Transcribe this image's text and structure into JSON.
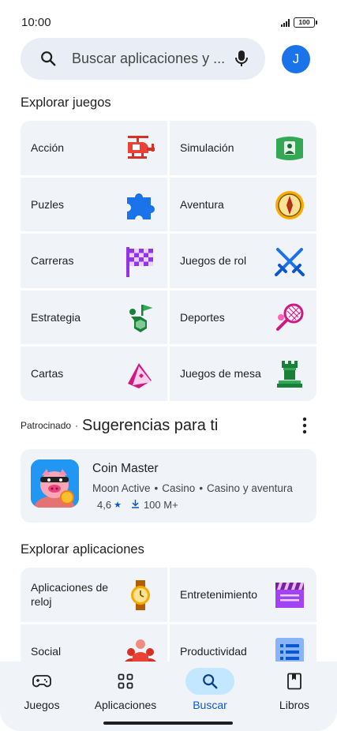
{
  "status_bar": {
    "time": "10:00",
    "battery": "100"
  },
  "search": {
    "placeholder": "Buscar aplicaciones y ...",
    "icon": "search-icon",
    "mic_icon": "mic-icon"
  },
  "account": {
    "initial": "J",
    "color": "#1a73e8"
  },
  "explore_games": {
    "title": "Explorar juegos",
    "categories": [
      {
        "label": "Acción",
        "icon": "helicopter-icon"
      },
      {
        "label": "Simulación",
        "icon": "simulation-icon"
      },
      {
        "label": "Puzles",
        "icon": "puzzle-piece-icon"
      },
      {
        "label": "Aventura",
        "icon": "compass-icon"
      },
      {
        "label": "Carreras",
        "icon": "checkered-flag-icon"
      },
      {
        "label": "Juegos de rol",
        "icon": "crossed-swords-icon"
      },
      {
        "label": "Estrategia",
        "icon": "strategy-flag-icon"
      },
      {
        "label": "Deportes",
        "icon": "tennis-racket-icon"
      },
      {
        "label": "Cartas",
        "icon": "cards-icon"
      },
      {
        "label": "Juegos de mesa",
        "icon": "chess-rook-icon"
      }
    ]
  },
  "suggestions": {
    "sponsored_label": "Patrocinado",
    "separator": "·",
    "title": "Sugerencias para ti",
    "app": {
      "name": "Coin Master",
      "developer": "Moon Active",
      "category": "Casino",
      "subcategory": "Casino y aventura",
      "rating": "4,6",
      "downloads": "100 M+"
    }
  },
  "explore_apps": {
    "title": "Explorar aplicaciones",
    "categories": [
      {
        "label": "Aplicaciones de reloj",
        "icon": "watch-icon"
      },
      {
        "label": "Entretenimiento",
        "icon": "clapperboard-icon"
      },
      {
        "label": "Social",
        "icon": "people-icon"
      },
      {
        "label": "Productividad",
        "icon": "checklist-icon"
      }
    ]
  },
  "bottom_nav": {
    "items": [
      {
        "label": "Juegos",
        "icon": "gamepad-icon",
        "active": false
      },
      {
        "label": "Aplicaciones",
        "icon": "apps-grid-icon",
        "active": false
      },
      {
        "label": "Buscar",
        "icon": "search-icon",
        "active": true
      },
      {
        "label": "Libros",
        "icon": "book-icon",
        "active": false
      }
    ]
  },
  "colors": {
    "accent": "#0b57d0",
    "active_pill": "#c2e7ff",
    "surface": "#f0f4f9"
  }
}
